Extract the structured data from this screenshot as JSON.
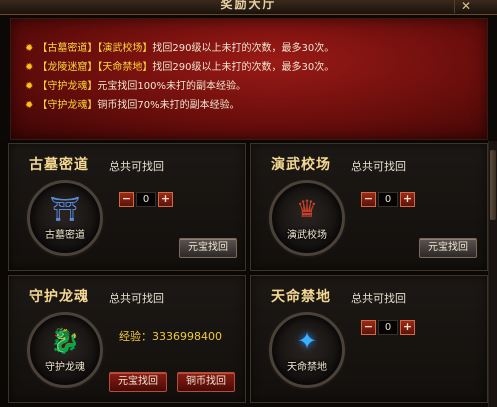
{
  "header": {
    "title": "奖励大厅",
    "close": "✕"
  },
  "info": [
    {
      "tags": [
        "【古墓密道】",
        "【演武校场】"
      ],
      "text": "找回290级以上未打的次数，最多30次。"
    },
    {
      "tags": [
        "【龙陵迷窟】",
        "【天命禁地】"
      ],
      "text": "找回290级以上未打的次数，最多30次。"
    },
    {
      "tags": [
        "【守护龙魂】"
      ],
      "text": "元宝找回100%未打的副本经验。"
    },
    {
      "tags": [
        "【守护龙魂】"
      ],
      "text": "铜币找回70%未打的副本经验。"
    }
  ],
  "cards": [
    {
      "name": "古墓密道",
      "total_label": "总共可找回",
      "emblem_label": "古墓密道",
      "emblem_icon": "tomb-emblem-icon",
      "count": "0",
      "minus": "−",
      "plus": "+",
      "buttons": [
        "元宝找回"
      ]
    },
    {
      "name": "演武校场",
      "total_label": "总共可找回",
      "emblem_label": "演武校场",
      "emblem_icon": "arena-emblem-icon",
      "count": "0",
      "minus": "−",
      "plus": "+",
      "buttons": [
        "元宝找回"
      ]
    },
    {
      "name": "守护龙魂",
      "total_label": "总共可找回",
      "emblem_label": "守护龙魂",
      "emblem_icon": "dragon-soul-emblem-icon",
      "exp": "经验：3336998400",
      "buttons": [
        "元宝找回",
        "铜币找回"
      ]
    },
    {
      "name": "天命禁地",
      "total_label": "总共可找回",
      "emblem_label": "天命禁地",
      "emblem_icon": "forbidden-land-emblem-icon",
      "count": "0",
      "minus": "−",
      "plus": "+",
      "buttons": []
    }
  ],
  "colors": {
    "accent_gold": "#f4d892",
    "highlight_yellow": "#ffd93a",
    "panel_red": "#7a1210"
  }
}
